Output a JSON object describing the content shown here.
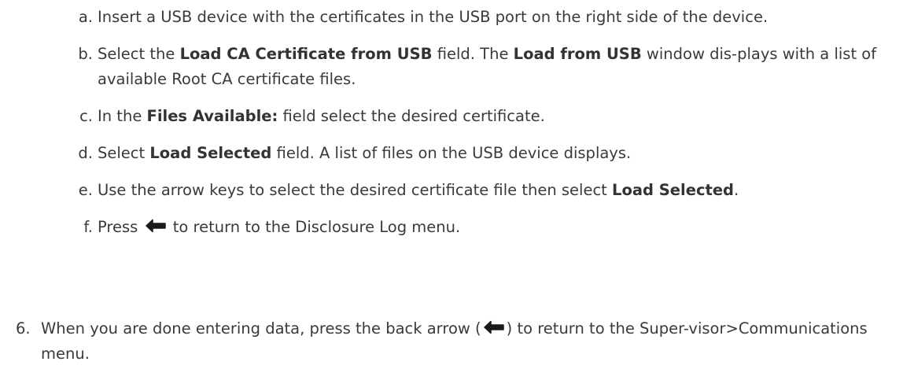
{
  "substeps": [
    {
      "marker": "a.",
      "parts": [
        {
          "text": "Insert a USB device with the certificates in the USB port on the right side of the device.",
          "bold": false
        }
      ]
    },
    {
      "marker": "b.",
      "parts": [
        {
          "text": "Select the ",
          "bold": false
        },
        {
          "text": "Load CA Certificate from USB",
          "bold": true
        },
        {
          "text": " field. The ",
          "bold": false
        },
        {
          "text": "Load from USB",
          "bold": true
        },
        {
          "text": " window dis-plays with a list of available Root CA certificate files.",
          "bold": false
        }
      ]
    },
    {
      "marker": "c.",
      "parts": [
        {
          "text": "In the ",
          "bold": false
        },
        {
          "text": "Files Available:",
          "bold": true
        },
        {
          "text": " field select the desired certificate.",
          "bold": false
        }
      ]
    },
    {
      "marker": "d.",
      "parts": [
        {
          "text": "Select ",
          "bold": false
        },
        {
          "text": "Load Selected",
          "bold": true
        },
        {
          "text": " field. A list of files on the USB device displays.",
          "bold": false
        }
      ]
    },
    {
      "marker": "e.",
      "parts": [
        {
          "text": "Use the arrow keys to select the desired certificate file then select ",
          "bold": false
        },
        {
          "text": "Load Selected",
          "bold": true
        },
        {
          "text": ".",
          "bold": false
        }
      ]
    }
  ],
  "substep_f": {
    "marker": "f.",
    "before": "Press ",
    "after": " to return to the Disclosure Log menu."
  },
  "step6": {
    "marker": "6.",
    "before": "When you are done entering data, press the back arrow (",
    "after": ") to return to the Super-visor>Communications menu."
  },
  "icons": {
    "back": "back-arrow-icon",
    "color": "#1a1a1a"
  }
}
